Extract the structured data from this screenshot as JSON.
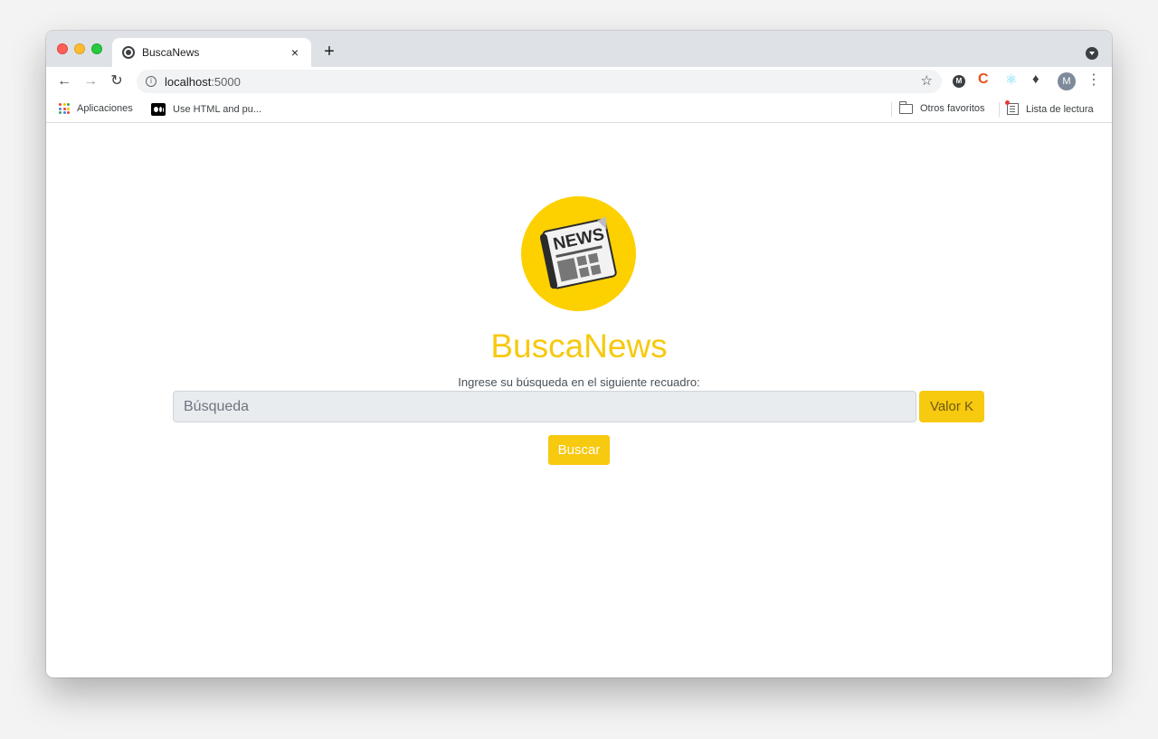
{
  "browser": {
    "tab_title": "BuscaNews",
    "close_glyph": "×",
    "new_tab_glyph": "+",
    "url_host": "localhost",
    "url_port": ":5000",
    "avatar_letter": "M",
    "ext_m_letter": "M",
    "ext_c_letter": "C"
  },
  "bookmarks": {
    "apps_label": "Aplicaciones",
    "html_label": "Use HTML and pu...",
    "others_label": "Otros favoritos",
    "reading_label": "Lista de lectura"
  },
  "page": {
    "brand": "BuscaNews",
    "logo_text": "NEWS",
    "prompt": "Ingrese su búsqueda en el siguiente recuadro:",
    "search_placeholder": "Búsqueda",
    "valor_k_label": "Valor K",
    "search_button_label": "Buscar"
  },
  "colors": {
    "accent": "#f7c90f",
    "chrome_bar": "#dee1e6"
  },
  "icons": {
    "back": "arrow-left-icon",
    "forward": "arrow-right-icon",
    "reload": "reload-icon",
    "info": "info-icon",
    "star": "star-icon",
    "puzzle": "puzzle-icon",
    "apps": "apps-grid-icon",
    "folder": "folder-icon",
    "reading": "reading-list-icon"
  }
}
